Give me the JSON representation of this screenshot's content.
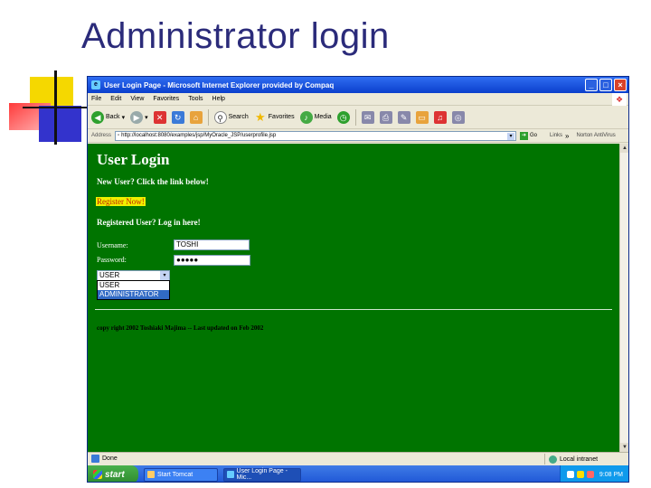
{
  "slide": {
    "title": "Administrator login"
  },
  "window": {
    "title": "User Login Page - Microsoft Internet Explorer provided by Compaq",
    "controls": [
      "_",
      "□",
      "×"
    ]
  },
  "menubar": {
    "items": [
      "File",
      "Edit",
      "View",
      "Favorites",
      "Tools",
      "Help"
    ]
  },
  "toolbar": {
    "back": "Back",
    "search": "Search",
    "favorites": "Favorites",
    "media": "Media"
  },
  "addressbar": {
    "label": "Address",
    "url": "http://localhost:8080/examples/jsp/MyOracle_JSP/userprofile.jsp",
    "go": "Go",
    "links": "Links",
    "chevron": "»",
    "norton": "Norton AntiVirus"
  },
  "content": {
    "heading": "User Login",
    "new_user": "New User? Click the link below!",
    "register_link": "Register Now!",
    "registered_user": "Registered User? Log in here!",
    "username_label": "Username:",
    "username_value": "TOSHI",
    "password_label": "Password:",
    "password_value": "●●●●●",
    "role_selected": "USER",
    "role_options": [
      "USER",
      "ADMINISTRATOR"
    ],
    "copyright": "copy right 2002 Toshiaki Majima -- Last updated on Feb 2002"
  },
  "statusbar": {
    "status": "Done",
    "zone": "Local intranet"
  },
  "taskbar": {
    "start": "start",
    "tasks": [
      "Start Tomcat",
      "User Login Page - Mic..."
    ],
    "clock": "9:08 PM"
  },
  "colors": {
    "page_background": "#007400",
    "link_highlight": "#f0f000",
    "title_text": "#2b2b7a"
  }
}
